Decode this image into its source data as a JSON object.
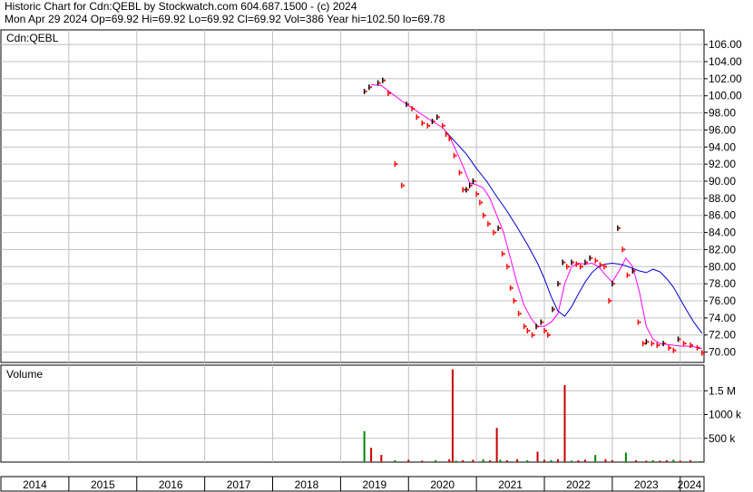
{
  "header": {
    "line1": "Historic Chart for Cdn:QEBL by Stockwatch.com 604.687.1500 - (c) 2024",
    "line2": "Mon Apr 29 2024   Op=69.92  Hi=69.92  Lo=69.92  Cl=69.92  Vol=386  Year hi=102.50  lo=69.78"
  },
  "colors": {
    "price_up": "#000000",
    "price_down": "#ff0000",
    "ma_short": "#ff00ff",
    "ma_long": "#0000cc",
    "vol_down": "#cc0000",
    "vol_up": "#008800",
    "grid": "#c0c0c0"
  },
  "chart_data": {
    "type": "line",
    "symbol": "Cdn:QEBL",
    "price_panel": {
      "ylim": [
        69,
        107.5
      ],
      "y_ticks": [
        "106.00",
        "104.00",
        "102.00",
        "100.00",
        "98.00",
        "96.00",
        "94.00",
        "92.00",
        "90.00",
        "88.00",
        "86.00",
        "84.00",
        "82.00",
        "80.00",
        "78.00",
        "76.00",
        "74.00",
        "72.00",
        "70.00"
      ],
      "grid": true
    },
    "volume_panel": {
      "label": "Volume",
      "y_ticks": [
        "1.5 M",
        "1000 k",
        "500 k"
      ],
      "ylim": [
        0,
        2000000
      ]
    },
    "x_ticks": [
      "2014",
      "2015",
      "2016",
      "2017",
      "2018",
      "2019",
      "2020",
      "2021",
      "2022",
      "2023",
      "2024"
    ],
    "series": [
      {
        "role": "price",
        "x": [
          2019.35,
          2019.42,
          2019.55,
          2019.62,
          2019.7,
          2019.8,
          2019.9,
          2019.97,
          2020.05,
          2020.12,
          2020.2,
          2020.28,
          2020.35,
          2020.42,
          2020.5,
          2020.55,
          2020.6,
          2020.67,
          2020.75,
          2020.8,
          2020.85,
          2020.9,
          2020.95,
          2021.0,
          2021.05,
          2021.1,
          2021.17,
          2021.25,
          2021.32,
          2021.38,
          2021.45,
          2021.5,
          2021.55,
          2021.62,
          2021.7,
          2021.75,
          2021.82,
          2021.88,
          2021.95,
          2022.0,
          2022.05,
          2022.12,
          2022.2,
          2022.27,
          2022.33,
          2022.4,
          2022.47,
          2022.53,
          2022.6,
          2022.67,
          2022.75,
          2022.82,
          2022.88,
          2022.95,
          2023.0,
          2023.08,
          2023.15,
          2023.22,
          2023.3,
          2023.38,
          2023.45,
          2023.5,
          2023.58,
          2023.66,
          2023.75,
          2023.83,
          2023.9,
          2023.97,
          2024.05,
          2024.15,
          2024.25,
          2024.32
        ],
        "values": [
          100.5,
          101.0,
          101.5,
          101.8,
          100.3,
          92.0,
          89.5,
          99.0,
          98.5,
          97.5,
          96.8,
          96.5,
          97.0,
          97.5,
          96.5,
          95.5,
          95.0,
          93.0,
          91.0,
          89.0,
          89.0,
          89.5,
          90.0,
          88.5,
          87.5,
          86.0,
          85.0,
          84.0,
          84.5,
          81.5,
          80.0,
          77.5,
          76.0,
          74.5,
          73.0,
          72.5,
          72.0,
          73.0,
          73.5,
          72.5,
          72.0,
          75.0,
          78.0,
          80.5,
          80.0,
          80.5,
          80.3,
          80.0,
          80.5,
          81.0,
          80.7,
          80.2,
          80.0,
          76.0,
          78.0,
          84.5,
          82.0,
          79.0,
          79.5,
          73.5,
          71.0,
          71.2,
          71.0,
          70.8,
          71.0,
          70.5,
          70.2,
          71.5,
          71.0,
          70.8,
          70.5,
          69.9
        ]
      },
      {
        "role": "moving-average-short",
        "x": [
          2019.45,
          2019.6,
          2019.75,
          2019.9,
          2020.05,
          2020.2,
          2020.35,
          2020.5,
          2020.6,
          2020.7,
          2020.8,
          2020.9,
          2021.0,
          2021.1,
          2021.2,
          2021.3,
          2021.4,
          2021.5,
          2021.6,
          2021.7,
          2021.8,
          2021.9,
          2022.0,
          2022.1,
          2022.2,
          2022.3,
          2022.4,
          2022.5,
          2022.6,
          2022.7,
          2022.8,
          2022.9,
          2023.0,
          2023.1,
          2023.2,
          2023.3,
          2023.4,
          2023.5,
          2023.6,
          2023.7,
          2023.8,
          2023.9,
          2024.0,
          2024.1,
          2024.2,
          2024.32
        ],
        "values": [
          101.3,
          101.2,
          100.3,
          99.4,
          98.6,
          97.8,
          97.0,
          96.3,
          95.3,
          93.6,
          91.8,
          89.8,
          89.6,
          89.2,
          88.0,
          86.0,
          84.0,
          81.0,
          78.0,
          75.5,
          74.0,
          73.0,
          73.0,
          73.5,
          74.5,
          78.0,
          80.0,
          80.4,
          80.3,
          80.4,
          80.0,
          79.0,
          78.2,
          79.5,
          81.0,
          80.0,
          77.0,
          73.0,
          71.5,
          71.0,
          70.9,
          70.8,
          70.7,
          70.7,
          70.6,
          70.4
        ]
      },
      {
        "role": "moving-average-long",
        "x": [
          2020.55,
          2020.7,
          2020.85,
          2021.0,
          2021.15,
          2021.3,
          2021.45,
          2021.6,
          2021.75,
          2021.9,
          2022.0,
          2022.1,
          2022.2,
          2022.3,
          2022.4,
          2022.5,
          2022.6,
          2022.7,
          2022.8,
          2022.9,
          2023.0,
          2023.1,
          2023.2,
          2023.3,
          2023.4,
          2023.5,
          2023.6,
          2023.7,
          2023.8,
          2023.9,
          2024.0,
          2024.1,
          2024.2,
          2024.32
        ],
        "values": [
          95.8,
          94.5,
          93.2,
          91.5,
          90.0,
          88.2,
          86.5,
          84.6,
          82.6,
          80.4,
          78.6,
          76.5,
          74.8,
          74.2,
          75.3,
          76.8,
          78.2,
          79.3,
          80.0,
          80.3,
          80.4,
          80.3,
          80.1,
          79.8,
          79.5,
          79.3,
          79.7,
          79.4,
          78.6,
          77.6,
          76.2,
          74.8,
          73.5,
          72.2
        ]
      },
      {
        "role": "volume",
        "x": [
          2019.35,
          2019.45,
          2019.6,
          2019.8,
          2020.0,
          2020.2,
          2020.4,
          2020.6,
          2020.65,
          2020.7,
          2020.8,
          2020.95,
          2021.1,
          2021.2,
          2021.3,
          2021.35,
          2021.45,
          2021.6,
          2021.75,
          2021.9,
          2022.0,
          2022.1,
          2022.2,
          2022.3,
          2022.4,
          2022.5,
          2022.6,
          2022.75,
          2022.9,
          2023.0,
          2023.2,
          2023.35,
          2023.5,
          2023.6,
          2023.7,
          2023.8,
          2023.9,
          2024.0,
          2024.15,
          2024.3
        ],
        "values": [
          650000,
          300000,
          150000,
          40000,
          50000,
          30000,
          40000,
          60000,
          1950000,
          30000,
          40000,
          50000,
          60000,
          40000,
          720000,
          50000,
          40000,
          60000,
          40000,
          220000,
          50000,
          40000,
          60000,
          1620000,
          30000,
          40000,
          50000,
          150000,
          60000,
          40000,
          200000,
          40000,
          30000,
          40000,
          30000,
          40000,
          50000,
          30000,
          40000,
          20000
        ]
      }
    ]
  }
}
